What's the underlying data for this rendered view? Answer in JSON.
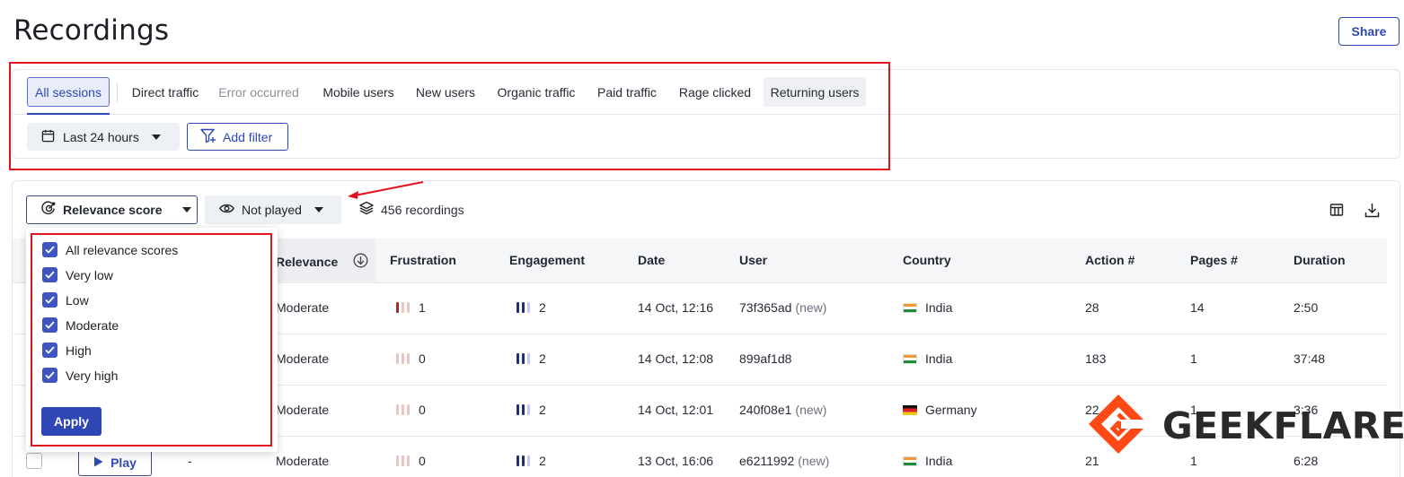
{
  "page": {
    "title": "Recordings",
    "share_label": "Share"
  },
  "segments": [
    {
      "label": "All sessions",
      "state": "active"
    },
    {
      "label": "Direct traffic",
      "state": "normal"
    },
    {
      "label": "Error occurred",
      "state": "muted"
    },
    {
      "label": "Mobile users",
      "state": "normal"
    },
    {
      "label": "New users",
      "state": "normal"
    },
    {
      "label": "Organic traffic",
      "state": "normal"
    },
    {
      "label": "Paid traffic",
      "state": "normal"
    },
    {
      "label": "Rage clicked",
      "state": "normal"
    },
    {
      "label": "Returning users",
      "state": "hover"
    }
  ],
  "filters": {
    "date_label": "Last 24 hours",
    "add_filter_label": "Add filter"
  },
  "toolbar": {
    "relevance_label": "Relevance score",
    "played_label": "Not played",
    "count_label": "456 recordings"
  },
  "relevance_menu": {
    "options": [
      "All relevance scores",
      "Very low",
      "Low",
      "Moderate",
      "High",
      "Very high"
    ],
    "checked": [
      true,
      true,
      true,
      true,
      true,
      true
    ],
    "apply_label": "Apply"
  },
  "table": {
    "columns": [
      "Relevance",
      "Frustration",
      "Engagement",
      "Date",
      "User",
      "Country",
      "Action #",
      "Pages #",
      "Duration"
    ],
    "rows": [
      {
        "relevance": "Moderate",
        "frustration": "1",
        "engagement": "2",
        "date": "14 Oct, 12:16",
        "user": "73f365ad",
        "user_tag": "(new)",
        "country": "India",
        "actions": "28",
        "pages": "14",
        "duration": "2:50"
      },
      {
        "relevance": "Moderate",
        "frustration": "0",
        "engagement": "2",
        "date": "14 Oct, 12:08",
        "user": "899af1d8",
        "user_tag": "",
        "country": "India",
        "actions": "183",
        "pages": "1",
        "duration": "37:48"
      },
      {
        "relevance": "Moderate",
        "frustration": "0",
        "engagement": "2",
        "date": "14 Oct, 12:01",
        "user": "240f08e1",
        "user_tag": "(new)",
        "country": "Germany",
        "actions": "22",
        "pages": "1",
        "duration": "3:36"
      },
      {
        "relevance": "Moderate",
        "frustration": "0",
        "engagement": "2",
        "date": "13 Oct, 16:06",
        "user": "e6211992",
        "user_tag": "(new)",
        "country": "India",
        "actions": "21",
        "pages": "1",
        "duration": "6:28"
      }
    ],
    "row4_play_label": "Play",
    "row4_dash": "-"
  },
  "watermark": {
    "text": "GEEKFLARE"
  },
  "colors": {
    "primary": "#2f47b5",
    "highlight_red": "#e0141e",
    "frustration_bar": "#a52a2a",
    "engagement_bar": "#1f2f7a"
  }
}
